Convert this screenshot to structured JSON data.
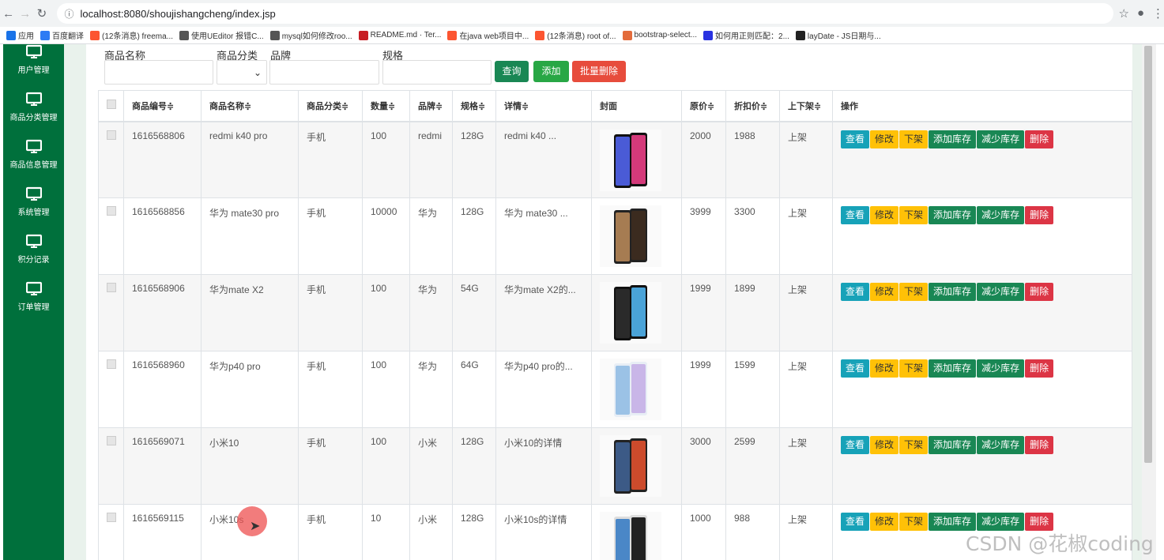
{
  "browser": {
    "url": "localhost:8080/shoujishangcheng/index.jsp",
    "bookmarks": [
      {
        "label": "应用",
        "icon": "apps-grid-icon",
        "color": "#1a73e8"
      },
      {
        "label": "百度翻译",
        "icon": "baidu-translate-icon",
        "color": "#2d7bf4"
      },
      {
        "label": "(12条消息) freema...",
        "icon": "csdn-icon",
        "color": "#fc5531"
      },
      {
        "label": "使用UEditor 报错C...",
        "icon": "ueditor-icon",
        "color": "#555555"
      },
      {
        "label": "mysql如何修改roo...",
        "icon": "ueditor-icon",
        "color": "#555555"
      },
      {
        "label": "README.md · Ter...",
        "icon": "gitee-icon",
        "color": "#c71d23"
      },
      {
        "label": "在java web项目中...",
        "icon": "csdn-icon",
        "color": "#fc5531"
      },
      {
        "label": "(12条消息) root of...",
        "icon": "csdn-icon",
        "color": "#fc5531"
      },
      {
        "label": "bootstrap-select...",
        "icon": "blog-icon",
        "color": "#e36b3b"
      },
      {
        "label": "如何用正则匹配：2...",
        "icon": "baidu-icon",
        "color": "#2932e1"
      },
      {
        "label": "layDate - JS日期与...",
        "icon": "laydate-icon",
        "color": "#222222"
      }
    ]
  },
  "sidebar": {
    "items": [
      {
        "label": "用户管理"
      },
      {
        "label": "商品分类管理"
      },
      {
        "label": "商品信息管理"
      },
      {
        "label": "系统管理"
      },
      {
        "label": "积分记录"
      },
      {
        "label": "订单管理"
      }
    ]
  },
  "search": {
    "name_label": "商品名称",
    "category_label": "商品分类",
    "brand_label": "品牌",
    "spec_label": "规格",
    "query_button": "查询",
    "add_button": "添加",
    "batch_delete_button": "批量删除",
    "colors": {
      "query": "#198754",
      "add": "#28a745",
      "delete": "#e74c3c"
    }
  },
  "table": {
    "headers": [
      "商品编号≑",
      "商品名称≑",
      "商品分类≑",
      "数量≑",
      "品牌≑",
      "规格≑",
      "详情≑",
      "封面",
      "原价≑",
      "折扣价≑",
      "上下架≑",
      "操作"
    ],
    "ops": {
      "view": "查看",
      "edit": "修改",
      "off": "下架",
      "add_stock": "添加库存",
      "sub_stock": "减少库存",
      "delete": "删除"
    },
    "rows": [
      {
        "id": "1616568806",
        "name": "redmi k40 pro",
        "category": "手机",
        "qty": "100",
        "brand": "redmi",
        "spec": "128G",
        "detail": "redmi k40 ...",
        "cover": "phone-image",
        "price": "2000",
        "discount": "1988",
        "status": "上架"
      },
      {
        "id": "1616568856",
        "name": "华为 mate30 pro",
        "category": "手机",
        "qty": "10000",
        "brand": "华为",
        "spec": "128G",
        "detail": "华为 mate30 ...",
        "cover": "phone-image",
        "price": "3999",
        "discount": "3300",
        "status": "上架"
      },
      {
        "id": "1616568906",
        "name": "华为mate X2",
        "category": "手机",
        "qty": "100",
        "brand": "华为",
        "spec": "54G",
        "detail": "华为mate X2的...",
        "cover": "phone-image",
        "price": "1999",
        "discount": "1899",
        "status": "上架"
      },
      {
        "id": "1616568960",
        "name": "华为p40 pro",
        "category": "手机",
        "qty": "100",
        "brand": "华为",
        "spec": "64G",
        "detail": "华为p40 pro的...",
        "cover": "phone-image",
        "price": "1999",
        "discount": "1599",
        "status": "上架"
      },
      {
        "id": "1616569071",
        "name": "小米10",
        "category": "手机",
        "qty": "100",
        "brand": "小米",
        "spec": "128G",
        "detail": "小米10的详情",
        "cover": "phone-image",
        "price": "3000",
        "discount": "2599",
        "status": "上架"
      },
      {
        "id": "1616569115",
        "name": "小米10s",
        "category": "手机",
        "qty": "10",
        "brand": "小米",
        "spec": "128G",
        "detail": "小米10s的详情",
        "cover": "phone-image",
        "price": "1000",
        "discount": "988",
        "status": "上架"
      }
    ]
  },
  "watermark": "CSDN @花椒coding",
  "colors": {
    "sidebar": "#00703c",
    "view": "#17a2b8",
    "warning": "#ffc107",
    "success": "#198754",
    "danger": "#dc3545"
  }
}
